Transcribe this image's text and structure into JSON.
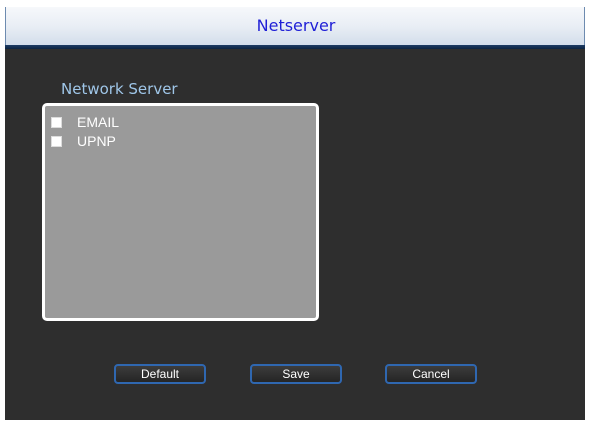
{
  "window": {
    "title": "Netserver"
  },
  "section": {
    "label": "Network Server"
  },
  "list": {
    "items": [
      {
        "label": "EMAIL",
        "checked": false
      },
      {
        "label": "UPNP",
        "checked": false
      }
    ]
  },
  "buttons": {
    "default_label": "Default",
    "save_label": "Save",
    "cancel_label": "Cancel"
  },
  "colors": {
    "title_text": "#1f1fd6",
    "section_label": "#9fc6e8",
    "list_background": "#9a9a9a",
    "button_border": "#2f67b0",
    "window_background": "#2e2e2e"
  }
}
